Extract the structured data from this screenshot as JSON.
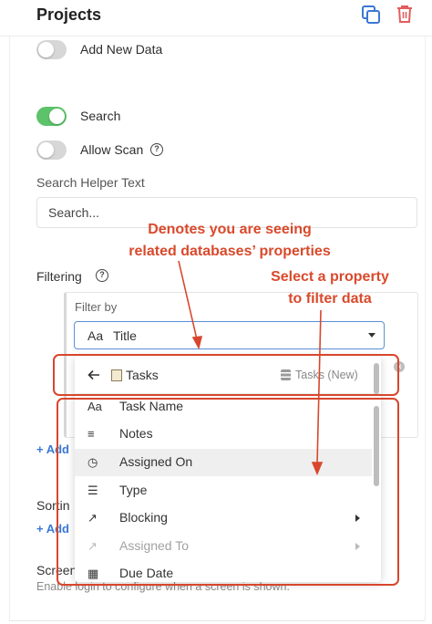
{
  "header": {
    "title": "Projects",
    "copy_icon": "copy-icon",
    "delete_icon": "trash-icon"
  },
  "toggles": [
    {
      "label": "Add New Data",
      "on": false
    },
    {
      "label": "Search",
      "on": true
    },
    {
      "label": "Allow Scan",
      "on": false
    }
  ],
  "search_helper": {
    "label": "Search Helper Text",
    "placeholder": "Search..."
  },
  "filtering": {
    "label": "Filtering",
    "filter_by": "Filter by",
    "selected_icon": "Aa",
    "selected": "Title",
    "add_label": "+ Add",
    "database": {
      "name": "Tasks",
      "parent": "Tasks (New)"
    },
    "options": [
      {
        "icon": "Aa",
        "label": "Task Name",
        "submenu": false,
        "disabled": false
      },
      {
        "icon": "≡",
        "label": "Notes",
        "submenu": false,
        "disabled": false
      },
      {
        "icon": "◷",
        "label": "Assigned On",
        "submenu": false,
        "disabled": false
      },
      {
        "icon": "☰",
        "label": "Type",
        "submenu": false,
        "disabled": false
      },
      {
        "icon": "↗",
        "label": "Blocking",
        "submenu": true,
        "disabled": false
      },
      {
        "icon": "↗",
        "label": "Assigned To",
        "submenu": true,
        "disabled": true
      },
      {
        "icon": "▦",
        "label": "Due Date",
        "submenu": false,
        "disabled": false
      }
    ]
  },
  "sorting": {
    "label": "Sortin",
    "add_label": "+ Add"
  },
  "screen": {
    "label": "Screen",
    "note": "Enable login to configure when a screen is shown."
  },
  "annotations": {
    "callout_1": [
      "Denotes you are seeing",
      "related databases’ properties"
    ],
    "callout_2": [
      "Select a property",
      "to filter data"
    ],
    "color": "#d8462d"
  },
  "colors": {
    "accent": "#3a78d4",
    "toggle_on": "#5cc36b",
    "delete": "#e35d5d"
  }
}
